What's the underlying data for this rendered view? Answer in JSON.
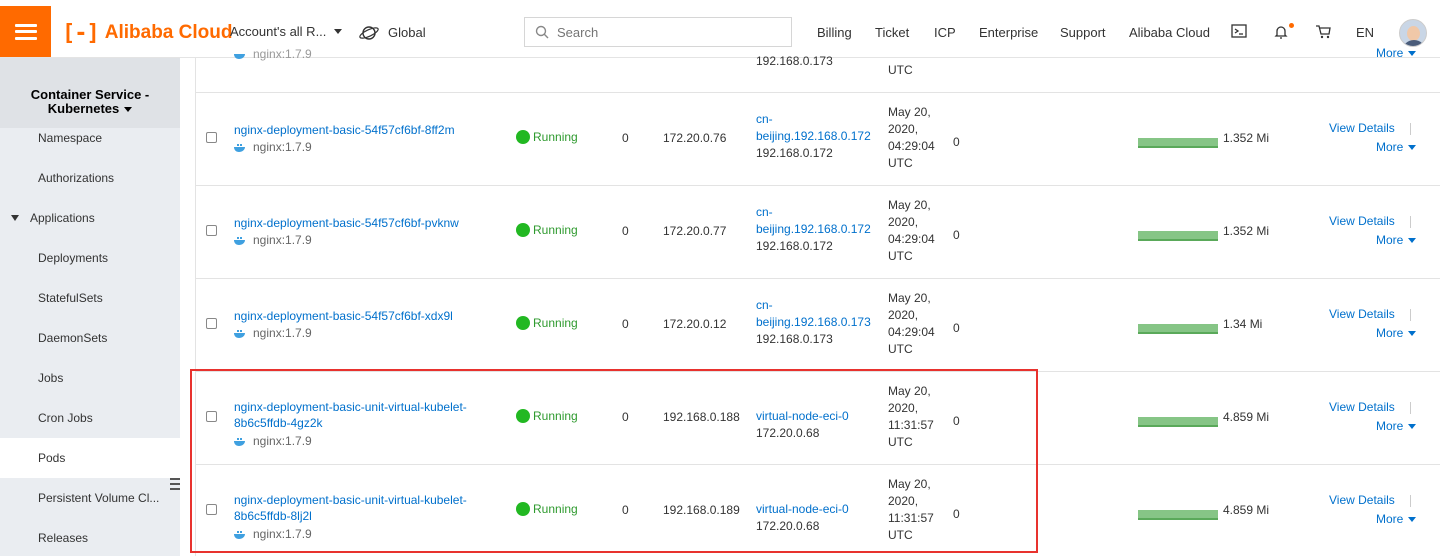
{
  "topbar": {
    "brand": "Alibaba Cloud",
    "account": "Account's all R...",
    "region": "Global",
    "search_placeholder": "Search",
    "nav": [
      "Billing",
      "Ticket",
      "ICP",
      "Enterprise",
      "Support",
      "Alibaba Cloud"
    ],
    "lang": "EN",
    "accent": "#ff6a00"
  },
  "sidebar": {
    "title_line1": "Container Service -",
    "title_line2": "Kubernetes",
    "items": [
      {
        "label": "Namespace"
      },
      {
        "label": "Authorizations"
      },
      {
        "label": "Applications"
      },
      {
        "label": "Deployments"
      },
      {
        "label": "StatefulSets"
      },
      {
        "label": "DaemonSets"
      },
      {
        "label": "Jobs"
      },
      {
        "label": "Cron Jobs"
      },
      {
        "label": "Pods"
      },
      {
        "label": "Persistent Volume Cl..."
      },
      {
        "label": "Releases"
      }
    ]
  },
  "table": {
    "partial_row": {
      "node_ip": "192.168.0.173",
      "time_tail": "UTC",
      "name_tail": "nginx:1.7.9",
      "more": "More"
    },
    "rows": [
      {
        "name_line1": "nginx-deployment-basic-54f57cf6bf-8ff2m",
        "name_line2": "",
        "image": "nginx:1.7.9",
        "status": "Running",
        "restarts": "0",
        "pod_ip": "172.20.0.76",
        "node_line1": "cn-",
        "node_line2": "beijing.192.168.0.172",
        "node_ip": "192.168.0.172",
        "time_line1": "May 20,",
        "time_line2": "2020,",
        "time_line3": "04:29:04",
        "time_line4": "UTC",
        "cpu": "0",
        "memory": "1.352 Mi",
        "view": "View Details",
        "more": "More"
      },
      {
        "name_line1": "nginx-deployment-basic-54f57cf6bf-pvknw",
        "name_line2": "",
        "image": "nginx:1.7.9",
        "status": "Running",
        "restarts": "0",
        "pod_ip": "172.20.0.77",
        "node_line1": "cn-",
        "node_line2": "beijing.192.168.0.172",
        "node_ip": "192.168.0.172",
        "time_line1": "May 20,",
        "time_line2": "2020,",
        "time_line3": "04:29:04",
        "time_line4": "UTC",
        "cpu": "0",
        "memory": "1.352 Mi",
        "view": "View Details",
        "more": "More"
      },
      {
        "name_line1": "nginx-deployment-basic-54f57cf6bf-xdx9l",
        "name_line2": "",
        "image": "nginx:1.7.9",
        "status": "Running",
        "restarts": "0",
        "pod_ip": "172.20.0.12",
        "node_line1": "cn-",
        "node_line2": "beijing.192.168.0.173",
        "node_ip": "192.168.0.173",
        "time_line1": "May 20,",
        "time_line2": "2020,",
        "time_line3": "04:29:04",
        "time_line4": "UTC",
        "cpu": "0",
        "memory": "1.34 Mi",
        "view": "View Details",
        "more": "More"
      },
      {
        "name_line1": "nginx-deployment-basic-unit-virtual-kubelet-",
        "name_line2": "8b6c5ffdb-4gz2k",
        "image": "nginx:1.7.9",
        "status": "Running",
        "restarts": "0",
        "pod_ip": "192.168.0.188",
        "node_line1": "virtual-node-eci-0",
        "node_line2": "",
        "node_ip": "172.20.0.68",
        "time_line1": "May 20,",
        "time_line2": "2020,",
        "time_line3": "11:31:57",
        "time_line4": "UTC",
        "cpu": "0",
        "memory": "4.859 Mi",
        "view": "View Details",
        "more": "More"
      },
      {
        "name_line1": "nginx-deployment-basic-unit-virtual-kubelet-",
        "name_line2": "8b6c5ffdb-8lj2l",
        "image": "nginx:1.7.9",
        "status": "Running",
        "restarts": "0",
        "pod_ip": "192.168.0.189",
        "node_line1": "virtual-node-eci-0",
        "node_line2": "",
        "node_ip": "172.20.0.68",
        "time_line1": "May 20,",
        "time_line2": "2020,",
        "time_line3": "11:31:57",
        "time_line4": "UTC",
        "cpu": "0",
        "memory": "4.859 Mi",
        "view": "View Details",
        "more": "More"
      }
    ]
  }
}
